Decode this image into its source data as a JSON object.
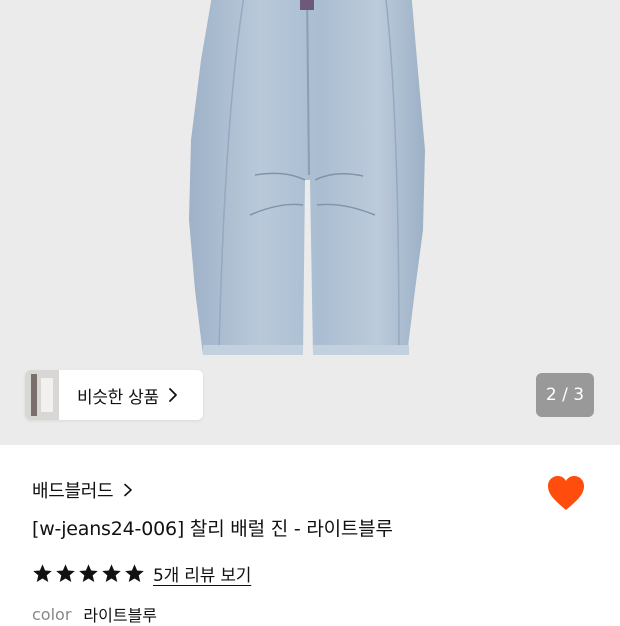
{
  "gallery": {
    "similar_label": "비슷한 상품",
    "page_indicator": "2 / 3",
    "current_page": 2,
    "total_pages": 3
  },
  "product": {
    "brand": "배드블러드",
    "title": "[w-jeans24-006] 찰리 배럴 진 - 라이트블루",
    "rating": 5,
    "review_link": "5개 리뷰 보기",
    "color_label": "color",
    "color_value": "라이트블루",
    "wishlisted": true
  },
  "colors": {
    "heart": "#ff4d0d",
    "hero_bg": "#ebebeb",
    "denim": "#a9bcd0"
  },
  "icons": [
    "chevron-right-icon",
    "heart-icon",
    "star-icon"
  ]
}
